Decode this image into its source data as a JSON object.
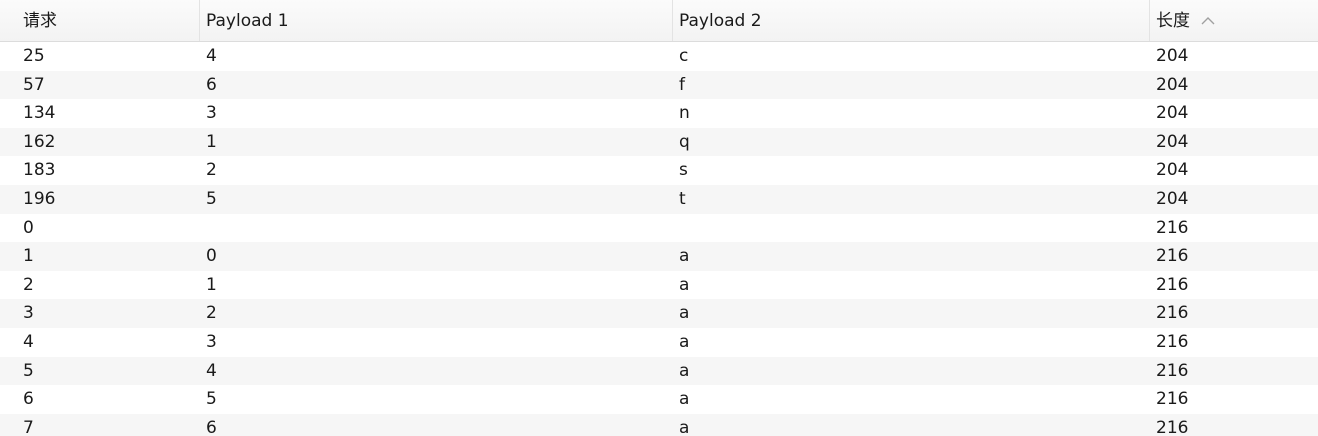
{
  "table": {
    "columns": [
      {
        "key": "request",
        "label": "请求"
      },
      {
        "key": "payload1",
        "label": "Payload 1"
      },
      {
        "key": "payload2",
        "label": "Payload 2"
      },
      {
        "key": "length",
        "label": "长度"
      }
    ],
    "sort": {
      "column": "length",
      "direction": "ascending",
      "icon": "chevron-up-icon"
    },
    "rows": [
      {
        "request": "25",
        "payload1": "4",
        "payload2": "c",
        "length": "204"
      },
      {
        "request": "57",
        "payload1": "6",
        "payload2": "f",
        "length": "204"
      },
      {
        "request": "134",
        "payload1": "3",
        "payload2": "n",
        "length": "204"
      },
      {
        "request": "162",
        "payload1": "1",
        "payload2": "q",
        "length": "204"
      },
      {
        "request": "183",
        "payload1": "2",
        "payload2": "s",
        "length": "204"
      },
      {
        "request": "196",
        "payload1": "5",
        "payload2": "t",
        "length": "204"
      },
      {
        "request": "0",
        "payload1": "",
        "payload2": "",
        "length": "216"
      },
      {
        "request": "1",
        "payload1": "0",
        "payload2": "a",
        "length": "216"
      },
      {
        "request": "2",
        "payload1": "1",
        "payload2": "a",
        "length": "216"
      },
      {
        "request": "3",
        "payload1": "2",
        "payload2": "a",
        "length": "216"
      },
      {
        "request": "4",
        "payload1": "3",
        "payload2": "a",
        "length": "216"
      },
      {
        "request": "5",
        "payload1": "4",
        "payload2": "a",
        "length": "216"
      },
      {
        "request": "6",
        "payload1": "5",
        "payload2": "a",
        "length": "216"
      },
      {
        "request": "7",
        "payload1": "6",
        "payload2": "a",
        "length": "216"
      }
    ]
  },
  "colors": {
    "alt_row": "#f6f6f6",
    "header_bg": "#f3f3f3",
    "sort_icon": "#a0a0a0"
  }
}
